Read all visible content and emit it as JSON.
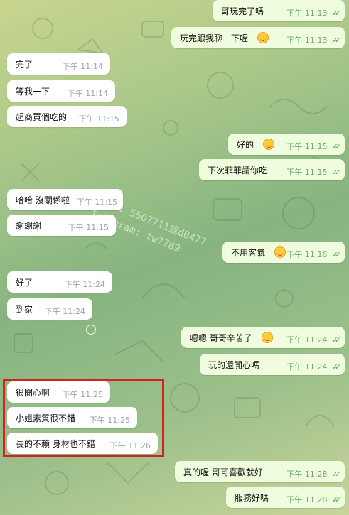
{
  "messages": [
    {
      "side": "out",
      "text": "哥玩完了嗎",
      "time": "下午 11:13",
      "emoji": false
    },
    {
      "side": "out",
      "text": "玩完跟我聊一下喔",
      "time": "下午 11:13",
      "emoji": true
    },
    {
      "side": "in",
      "text": "完了",
      "time": "下午 11:14"
    },
    {
      "side": "in",
      "text": "等我一下",
      "time": "下午 11:14"
    },
    {
      "side": "in",
      "text": "超商買個吃的",
      "time": "下午 11:15"
    },
    {
      "side": "out",
      "text": "好的",
      "time": "下午 11:15",
      "emoji": true
    },
    {
      "side": "out",
      "text": "下次菲菲請你吃",
      "time": "下午 11:15",
      "emoji": false
    },
    {
      "side": "in",
      "text": "哈哈 沒關係啦",
      "time": "下午 11:15"
    },
    {
      "side": "in",
      "text": "謝謝謝",
      "time": "下午 11:15"
    },
    {
      "side": "out",
      "text": "不用客氣",
      "time": "下午 11:16",
      "emoji": true
    },
    {
      "side": "in",
      "text": "好了",
      "time": "下午 11:24"
    },
    {
      "side": "in",
      "text": "到家",
      "time": "下午 11:24"
    },
    {
      "side": "out",
      "text": "嗯嗯 哥哥辛苦了",
      "time": "下午 11:24",
      "emoji": true
    },
    {
      "side": "out",
      "text": "玩的還開心嗎",
      "time": "下午 11:24",
      "emoji": false
    },
    {
      "side": "in",
      "text": "很開心啊",
      "time": "下午 11:25"
    },
    {
      "side": "in",
      "text": "小姐素質很不錯",
      "time": "下午 11:25"
    },
    {
      "side": "in",
      "text": "長的不賴 身材也不錯",
      "time": "下午 11:26"
    },
    {
      "side": "out",
      "text": "真的喔 哥哥喜歡就好",
      "time": "下午 11:28",
      "emoji": false
    },
    {
      "side": "out",
      "text": "服務好嗎",
      "time": "下午 11:28",
      "emoji": false
    }
  ],
  "watermark": {
    "line1": "Line: 5507711或d0477",
    "line2": "Telegram: tw7789"
  },
  "icons": {
    "read_receipt": "double-check-icon",
    "emoji": "smiling-face-icon",
    "cursor": "cursor-circle-icon"
  },
  "colors": {
    "incoming_bubble": "#ffffff",
    "outgoing_bubble": "#effdde",
    "check": "#4fae4e",
    "highlight_border": "#d32222"
  }
}
